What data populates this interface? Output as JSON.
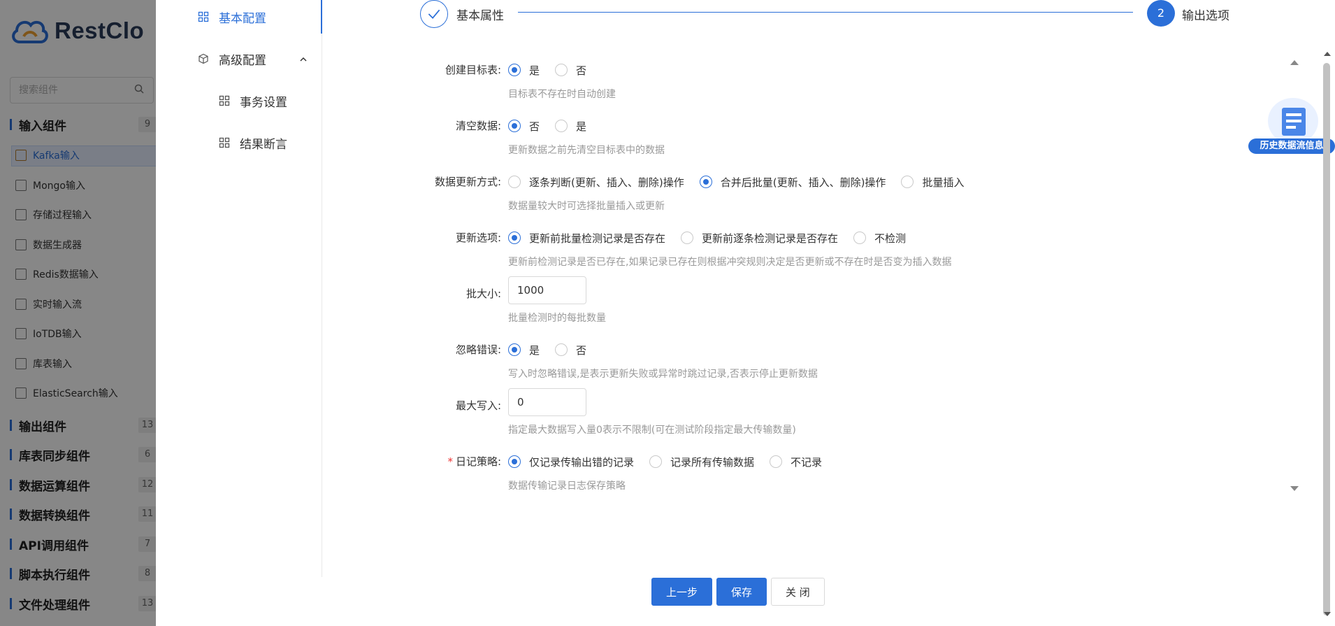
{
  "background": {
    "logo_text": "RestClo",
    "search_placeholder": "搜索组件",
    "categories": [
      {
        "name": "输入组件",
        "count": "9"
      },
      {
        "name": "输出组件",
        "count": "13"
      },
      {
        "name": "库表同步组件",
        "count": "6"
      },
      {
        "name": "数据运算组件",
        "count": "12"
      },
      {
        "name": "数据转换组件",
        "count": "11"
      },
      {
        "name": "API调用组件",
        "count": "7"
      },
      {
        "name": "脚本执行组件",
        "count": "8"
      },
      {
        "name": "文件处理组件",
        "count": "13"
      }
    ],
    "input_items": [
      "Kafka输入",
      "Mongo输入",
      "存储过程输入",
      "数据生成器",
      "Redis数据输入",
      "实时输入流",
      "IoTDB输入",
      "库表输入",
      "ElasticSearch输入"
    ]
  },
  "nav": {
    "basic": "基本配置",
    "advanced": "高级配置",
    "transaction": "事务设置",
    "assertion": "结果断言"
  },
  "steps": {
    "step1": "基本属性",
    "step2_num": "2",
    "step2": "输出选项"
  },
  "form": {
    "create_table": {
      "label": "创建目标表:",
      "opt1": "是",
      "opt2": "否",
      "hint": "目标表不存在时自动创建"
    },
    "clear_data": {
      "label": "清空数据:",
      "opt1": "否",
      "opt2": "是",
      "hint": "更新数据之前先清空目标表中的数据"
    },
    "update_mode": {
      "label": "数据更新方式:",
      "opt1": "逐条判断(更新、插入、删除)操作",
      "opt2": "合并后批量(更新、插入、删除)操作",
      "opt3": "批量插入",
      "hint": "数据量较大时可选择批量插入或更新"
    },
    "update_option": {
      "label": "更新选项:",
      "opt1": "更新前批量检测记录是否存在",
      "opt2": "更新前逐条检测记录是否存在",
      "opt3": "不检测",
      "hint": "更新前检测记录是否已存在,如果记录已存在则根据冲突规则决定是否更新或不存在时是否变为插入数据"
    },
    "batch_size": {
      "label": "批大小:",
      "value": "1000",
      "hint": "批量检测时的每批数量"
    },
    "ignore_error": {
      "label": "忽略错误:",
      "opt1": "是",
      "opt2": "否",
      "hint": "写入时忽略错误,是表示更新失败或异常时跳过记录,否表示停止更新数据"
    },
    "max_write": {
      "label": "最大写入:",
      "value": "0",
      "hint": "指定最大数据写入量0表示不限制(可在测试阶段指定最大传输数量)"
    },
    "log_policy": {
      "label": "日记策略:",
      "required_mark": "*",
      "opt1": "仅记录传输出错的记录",
      "opt2": "记录所有传输数据",
      "opt3": "不记录",
      "hint": "数据传输记录日志保存策略"
    }
  },
  "history": {
    "label": "历史数据流信息"
  },
  "footer": {
    "prev": "上一步",
    "save": "保存",
    "close": "关 闭"
  },
  "colors": {
    "primary": "#2b6fd8",
    "hint": "#999999",
    "overlay": "rgba(0,0,0,0.47)"
  }
}
